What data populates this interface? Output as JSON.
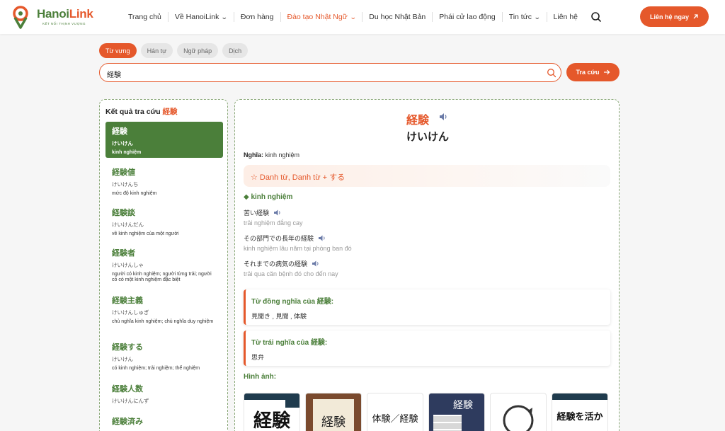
{
  "header": {
    "logo_main": "Hanoi",
    "logo_accent": "Link",
    "logo_tagline": "KẾT NỐI THỊNH VƯỢNG",
    "nav": [
      {
        "label": "Trang chủ",
        "dropdown": false,
        "active": false
      },
      {
        "label": "Về HanoiLink",
        "dropdown": true,
        "active": false
      },
      {
        "label": "Đơn hàng",
        "dropdown": false,
        "active": false
      },
      {
        "label": "Đào tạo Nhật Ngữ",
        "dropdown": true,
        "active": true
      },
      {
        "label": "Du học Nhật Bản",
        "dropdown": false,
        "active": false
      },
      {
        "label": "Phái cử lao động",
        "dropdown": false,
        "active": false
      },
      {
        "label": "Tin tức",
        "dropdown": true,
        "active": false
      },
      {
        "label": "Liên hệ",
        "dropdown": false,
        "active": false
      }
    ],
    "cta_label": "Liên hệ ngay"
  },
  "tabs": [
    {
      "label": "Từ vựng",
      "active": true
    },
    {
      "label": "Hán tự",
      "active": false
    },
    {
      "label": "Ngữ pháp",
      "active": false
    },
    {
      "label": "Dịch",
      "active": false
    }
  ],
  "search": {
    "value": "経験",
    "submit_label": "Tra cứu"
  },
  "results": {
    "title": "Kết quả tra cứu",
    "query": "経験",
    "items": [
      {
        "word": "経験",
        "kana": "けいけん",
        "meaning": "kinh nghiệm"
      },
      {
        "word": "経験値",
        "kana": "けいけんち",
        "meaning": "mức độ kinh nghiệm"
      },
      {
        "word": "経験談",
        "kana": "けいけんだん",
        "meaning": "về kinh nghiệm của một người"
      },
      {
        "word": "経験者",
        "kana": "けいけんしゃ",
        "meaning": "người có kinh nghiệm; người từng trải; người có có một kinh nghiệm đặc biệt"
      },
      {
        "word": "経験主義",
        "kana": "けいけんしゅぎ",
        "meaning": "chủ nghĩa kinh nghiệm; chủ nghĩa duy nghiệm"
      },
      {
        "word": "経験する",
        "kana": "けいけん",
        "meaning": "có kinh nghiệm; trải nghiệm; thể nghiệm"
      },
      {
        "word": "経験人数",
        "kana": "けいけんにんず",
        "meaning": ""
      },
      {
        "word": "経験済み",
        "kana": "",
        "meaning": ""
      }
    ]
  },
  "detail": {
    "word": "経験",
    "reading": "けいけん",
    "meaning_label": "Nghĩa:",
    "meaning": "kinh nghiệm",
    "pos": "☆ Danh từ, Danh từ + する",
    "sense": "◆ kinh nghiệm",
    "examples": [
      {
        "pre": "苦い",
        "word": "経験",
        "post": "",
        "vi": "trải nghiệm đắng cay"
      },
      {
        "pre": "その部門での長年の",
        "word": "経験",
        "post": "",
        "vi": "kinh nghiệm lâu năm tại phòng ban đó"
      },
      {
        "pre": "それまでの病気の",
        "word": "経験",
        "post": "",
        "vi": "trải qua căn bệnh đó cho đến nay"
      }
    ],
    "synonyms_title": "Từ đồng nghĩa của",
    "synonyms_word": "経験:",
    "synonyms": "見聞き , 見聞 , 体験",
    "antonyms_title": "Từ trái nghĩa của",
    "antonyms_word": "経験:",
    "antonyms": "思弁",
    "images_title": "Hình ảnh:",
    "thumbnails": [
      "経験",
      "経験",
      "体験／経験",
      "経験",
      "",
      "経験を活か"
    ]
  },
  "colors": {
    "accent": "#e5582b",
    "green": "#4b7f3a"
  }
}
